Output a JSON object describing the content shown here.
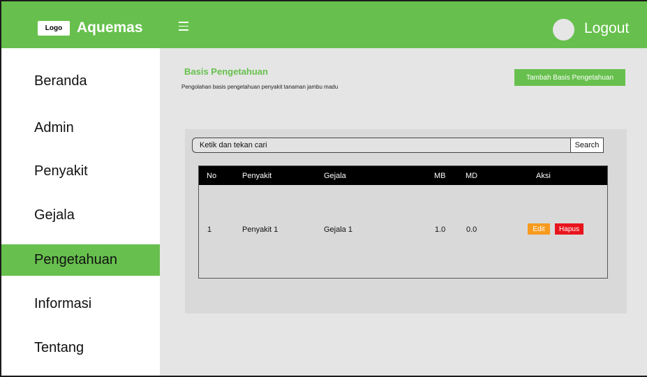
{
  "header": {
    "logo_text": "Logo",
    "brand": "Aquemas",
    "menu_icon": "hamburger-menu-icon",
    "avatar_icon": "user-avatar-icon",
    "logout_label": "Logout"
  },
  "sidebar": {
    "items": [
      {
        "label": "Beranda",
        "active": false
      },
      {
        "label": "Admin",
        "active": false
      },
      {
        "label": "Penyakit",
        "active": false
      },
      {
        "label": "Gejala",
        "active": false
      },
      {
        "label": "Pengetahuan",
        "active": true
      },
      {
        "label": "Informasi",
        "active": false
      },
      {
        "label": "Tentang",
        "active": false
      }
    ]
  },
  "main": {
    "title": "Basis Pengetahuan",
    "subtitle": "Pengolahan basis pengetahuan penyakit tanaman jambu madu",
    "add_button": "Tambah Basis Pengetahuan",
    "search": {
      "placeholder": "Ketik dan tekan cari",
      "button": "Search"
    },
    "table": {
      "columns": [
        "No",
        "Penyakit",
        "Gejala",
        "MB",
        "MD",
        "Aksi"
      ],
      "rows": [
        {
          "no": "1",
          "penyakit": "Penyakit 1",
          "gejala": "Gejala 1",
          "mb": "1.0",
          "md": "0.0",
          "edit": "Edit",
          "hapus": "Hapus"
        }
      ]
    }
  },
  "colors": {
    "brand_green": "#67c04d",
    "edit_orange": "#f79a1d",
    "delete_red": "#e8141c",
    "content_bg": "#e5e5e5"
  }
}
